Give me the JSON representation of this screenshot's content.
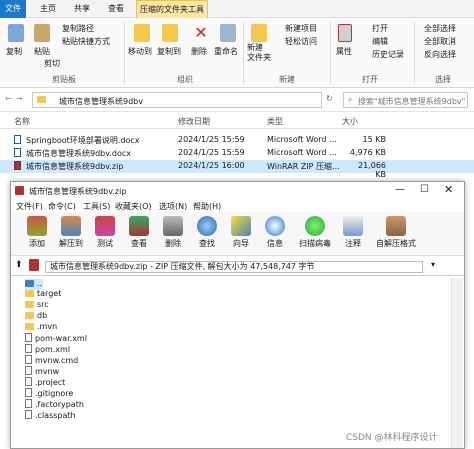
{
  "explorer": {
    "tabs": [
      "文件",
      "主页",
      "共享",
      "查看",
      "压缩的文件夹工具"
    ],
    "ribbon": {
      "copy": "复制",
      "paste": "粘贴",
      "copy_path": "复制路径",
      "paste_shortcut": "粘贴快捷方式",
      "cut": "剪切",
      "move_to": "移动到",
      "copy_to": "复制到",
      "delete": "删除",
      "rename": "重命名",
      "new_folder": "新建\n文件夹",
      "new_item": "新建项目",
      "easy_access": "轻松访问",
      "properties": "属性",
      "open": "打开",
      "edit": "编辑",
      "history": "历史记录",
      "select_all": "全部选择",
      "select_none": "全部取消",
      "invert": "反向选择",
      "groups": [
        "剪贴板",
        "组织",
        "新建",
        "打开",
        "选择"
      ]
    },
    "address": "城市信息管理系统9dbv",
    "search_placeholder": "搜索\"城市信息管理系统9dbv\"",
    "columns": [
      "名称",
      "修改日期",
      "类型",
      "大小"
    ],
    "files": [
      {
        "name": "Springboot环境部署说明.docx",
        "date": "2024/1/25 15:59",
        "type": "Microsoft Word ...",
        "size": "15 KB"
      },
      {
        "name": "城市信息管理系统9dbv.docx",
        "date": "2024/1/25 15:59",
        "type": "Microsoft Word ...",
        "size": "4,976 KB"
      },
      {
        "name": "城市信息管理系统9dbv.zip",
        "date": "2024/1/25 16:00",
        "type": "WinRAR ZIP 压缩...",
        "size": "21,066 KB"
      }
    ]
  },
  "winrar": {
    "title": "城市信息管理系统9dbv.zip",
    "menu": [
      "文件(F)",
      "命令(C)",
      "工具(S)",
      "收藏夹(O)",
      "选项(N)",
      "帮助(H)"
    ],
    "toolbar": [
      "添加",
      "解压到",
      "测试",
      "查看",
      "删除",
      "查找",
      "向导",
      "信息",
      "扫描病毒",
      "注释",
      "自解压格式"
    ],
    "path": "城市信息管理系统9dbv.zip - ZIP 压缩文件, 解包大小为 47,548,747 字节",
    "items": [
      {
        "name": "..",
        "kind": "up"
      },
      {
        "name": "target",
        "kind": "folder"
      },
      {
        "name": "src",
        "kind": "folder"
      },
      {
        "name": "db",
        "kind": "folder"
      },
      {
        "name": ".mvn",
        "kind": "folder"
      },
      {
        "name": "pom-war.xml",
        "kind": "file"
      },
      {
        "name": "pom.xml",
        "kind": "file"
      },
      {
        "name": "mvnw.cmd",
        "kind": "file"
      },
      {
        "name": "mvnw",
        "kind": "file"
      },
      {
        "name": ".project",
        "kind": "file"
      },
      {
        "name": ".gitignore",
        "kind": "file"
      },
      {
        "name": ".factorypath",
        "kind": "file"
      },
      {
        "name": ".classpath",
        "kind": "file"
      }
    ]
  },
  "watermark": "CSDN @林科程序设计",
  "colors": {
    "accent": "#1979ca",
    "selected": "#cde8ff",
    "folder": "#f4c84a"
  }
}
